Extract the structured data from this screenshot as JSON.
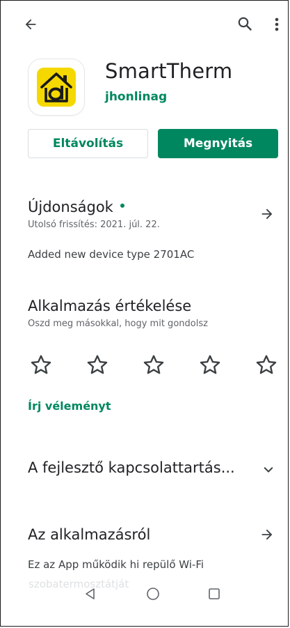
{
  "app": {
    "name": "SmartTherm",
    "developer": "jhonlinag",
    "icon": "house-o-logo"
  },
  "actions": {
    "uninstall_label": "Eltávolítás",
    "open_label": "Megnyitás"
  },
  "whats_new": {
    "title": "Újdonságok",
    "last_update": "Utolsó frissítés: 2021. júl. 22.",
    "notes": "Added new device type 2701AC"
  },
  "rating": {
    "title": "Alkalmazás értékelése",
    "subtitle": "Oszd meg másokkal, hogy mit gondolsz",
    "stars": 5,
    "selected": 0,
    "write_review": "Írj véleményt"
  },
  "developer_contact": {
    "title": "A fejlesztő kapcsolattartás..."
  },
  "about": {
    "title": "Az alkalmazásról",
    "line1": "Ez az App működik hi repülő Wi-Fi",
    "line2": "szobatermosztátját"
  },
  "colors": {
    "accent": "#01875f",
    "icon_yellow": "#f5d800"
  }
}
